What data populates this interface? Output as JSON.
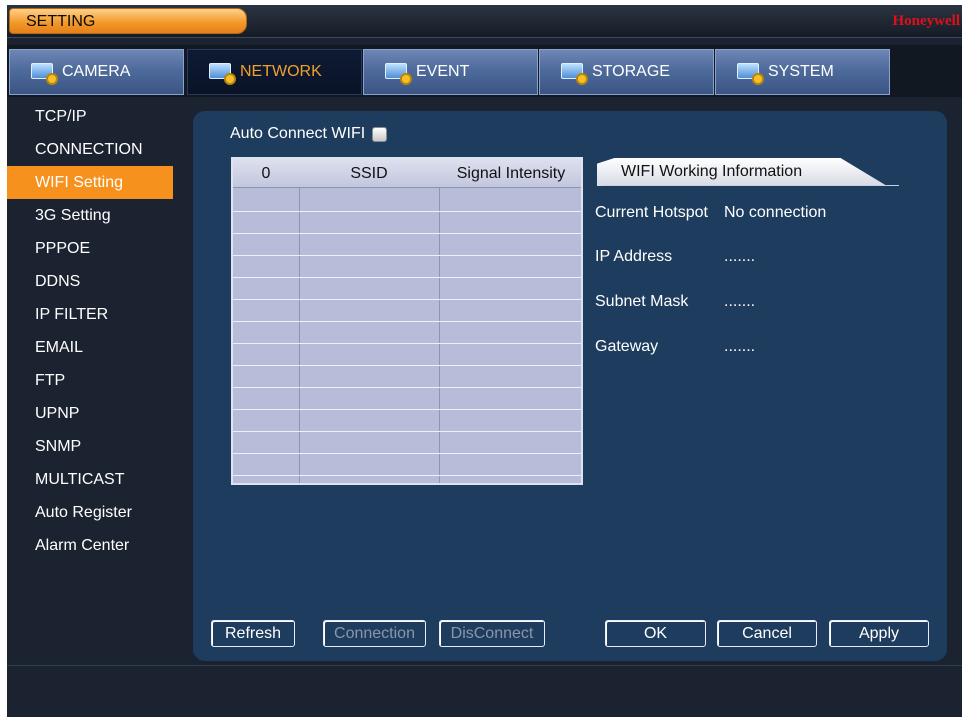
{
  "window": {
    "title": "SETTING",
    "brand": "Honeywell"
  },
  "tabs": [
    {
      "label": "CAMERA",
      "icon": "camera-settings-icon"
    },
    {
      "label": "NETWORK",
      "icon": "network-settings-icon",
      "active": true
    },
    {
      "label": "EVENT",
      "icon": "event-settings-icon"
    },
    {
      "label": "STORAGE",
      "icon": "storage-settings-icon"
    },
    {
      "label": "SYSTEM",
      "icon": "system-settings-icon"
    }
  ],
  "sidebar": {
    "items": [
      {
        "label": "TCP/IP"
      },
      {
        "label": "CONNECTION"
      },
      {
        "label": "WIFI Setting",
        "active": true
      },
      {
        "label": "3G Setting"
      },
      {
        "label": "PPPOE"
      },
      {
        "label": "DDNS"
      },
      {
        "label": "IP FILTER"
      },
      {
        "label": "EMAIL"
      },
      {
        "label": "FTP"
      },
      {
        "label": "UPNP"
      },
      {
        "label": "SNMP"
      },
      {
        "label": "MULTICAST"
      },
      {
        "label": "Auto Register"
      },
      {
        "label": "Alarm Center"
      }
    ]
  },
  "wifi": {
    "auto_connect_label": "Auto Connect WIFI",
    "auto_connect_checked": false,
    "table": {
      "columns": [
        "0",
        "SSID",
        "Signal Intensity"
      ],
      "rows": []
    },
    "info_tab_label": "WIFI Working Information",
    "info": {
      "current_hotspot_label": "Current Hotspot",
      "current_hotspot_value": "No connection",
      "ip_address_label": "IP Address",
      "ip_address_value": ".......",
      "subnet_mask_label": "Subnet Mask",
      "subnet_mask_value": ".......",
      "gateway_label": "Gateway",
      "gateway_value": "......."
    }
  },
  "buttons": {
    "refresh": "Refresh",
    "connection": "Connection",
    "disconnect": "DisConnect",
    "ok": "OK",
    "cancel": "Cancel",
    "apply": "Apply"
  },
  "colors": {
    "accent_orange": "#f7911d",
    "panel_blue": "#1e3c5e",
    "brand_red": "#e0101a"
  }
}
